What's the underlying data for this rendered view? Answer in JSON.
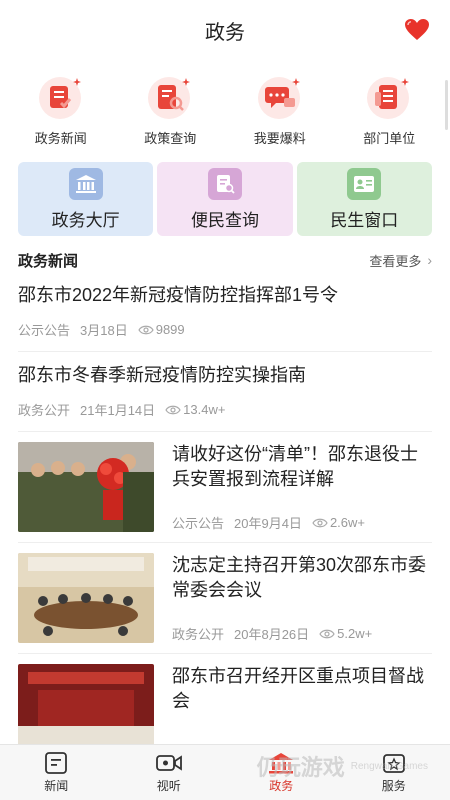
{
  "header": {
    "title": "政务"
  },
  "quick_links": [
    {
      "label": "政务新闻",
      "icon": "news-list-icon"
    },
    {
      "label": "政策查询",
      "icon": "policy-search-icon"
    },
    {
      "label": "我要爆料",
      "icon": "report-chat-icon"
    },
    {
      "label": "部门单位",
      "icon": "department-icon"
    }
  ],
  "cards": [
    {
      "label": "政务大厅",
      "icon": "government-hall-icon",
      "color": "#dde9f8"
    },
    {
      "label": "便民查询",
      "icon": "convenience-query-icon",
      "color": "#f5e3f4"
    },
    {
      "label": "民生窗口",
      "icon": "livelihood-window-icon",
      "color": "#def0dd"
    }
  ],
  "section": {
    "title": "政务新闻",
    "more": "查看更多"
  },
  "news": [
    {
      "title": "邵东市2022年新冠疫情防控指挥部1号令",
      "category": "公示公告",
      "date": "3月18日",
      "views": "9899"
    },
    {
      "title": "邵东市冬春季新冠疫情防控实操指南",
      "category": "政务公开",
      "date": "21年1月14日",
      "views": "13.4w+"
    },
    {
      "title": "请收好这份“清单”！邵东退役士兵安置报到流程详解",
      "category": "公示公告",
      "date": "20年9月4日",
      "views": "2.6w+"
    },
    {
      "title": "沈志定主持召开第30次邵东市委常委会会议",
      "category": "政务公开",
      "date": "20年8月26日",
      "views": "5.2w+"
    },
    {
      "title": "邵东市召开经开区重点项目督战会",
      "category": "",
      "date": "",
      "views": ""
    }
  ],
  "tabs": [
    {
      "label": "新闻",
      "icon": "news-tab-icon"
    },
    {
      "label": "视听",
      "icon": "video-tab-icon"
    },
    {
      "label": "政务",
      "icon": "government-tab-icon"
    },
    {
      "label": "服务",
      "icon": "service-tab-icon"
    }
  ],
  "watermark": {
    "text": "仍玩游戏",
    "sub": "Rengwan Games"
  },
  "colors": {
    "accent": "#d8362b",
    "icon_bg": "#fde8e6"
  }
}
